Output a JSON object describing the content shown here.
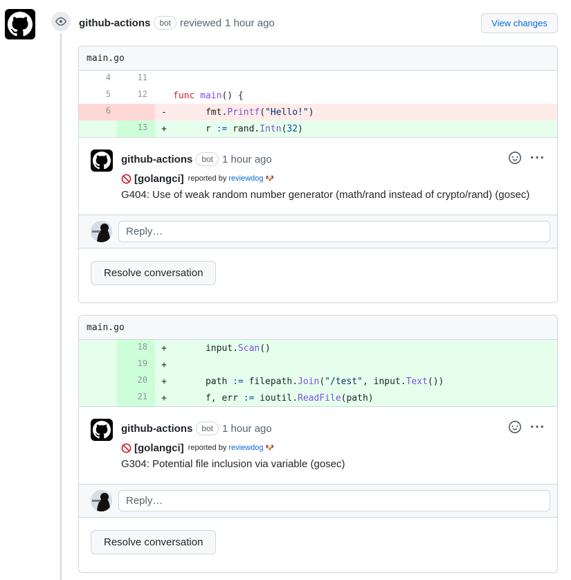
{
  "review": {
    "author": "github-actions",
    "badge": "bot",
    "action": "reviewed",
    "time": "1 hour ago",
    "view_changes_label": "View changes"
  },
  "threads": [
    {
      "file": "main.go",
      "lines": [
        {
          "old": "4",
          "new": "11",
          "marker": "",
          "type": "ctx",
          "code": ""
        },
        {
          "old": "5",
          "new": "12",
          "marker": "",
          "type": "ctx",
          "code": "func main() {"
        },
        {
          "old": "6",
          "new": "",
          "marker": "-",
          "type": "del",
          "code": "    fmt.Printf(\"Hello!\")"
        },
        {
          "old": "",
          "new": "13",
          "marker": "+",
          "type": "add",
          "code": "    r := rand.Intn(32)"
        }
      ],
      "comment": {
        "author": "github-actions",
        "badge": "bot",
        "time": "1 hour ago",
        "tag": "[golangci]",
        "reported_by": "reported by",
        "reporter": "reviewdog",
        "message": "G404: Use of weak random number generator (math/rand instead of crypto/rand) (gosec)"
      },
      "reply_placeholder": "Reply…",
      "resolve_label": "Resolve conversation"
    },
    {
      "file": "main.go",
      "lines": [
        {
          "old": "",
          "new": "18",
          "marker": "+",
          "type": "add",
          "code": "    input.Scan()"
        },
        {
          "old": "",
          "new": "19",
          "marker": "+",
          "type": "add",
          "code": ""
        },
        {
          "old": "",
          "new": "20",
          "marker": "+",
          "type": "add",
          "code": "    path := filepath.Join(\"/test\", input.Text())"
        },
        {
          "old": "",
          "new": "21",
          "marker": "+",
          "type": "add",
          "code": "    f, err := ioutil.ReadFile(path)"
        }
      ],
      "comment": {
        "author": "github-actions",
        "badge": "bot",
        "time": "1 hour ago",
        "tag": "[golangci]",
        "reported_by": "reported by",
        "reporter": "reviewdog",
        "message": "G304: Potential file inclusion via variable (gosec)"
      },
      "reply_placeholder": "Reply…",
      "resolve_label": "Resolve conversation"
    }
  ],
  "colors": {
    "accent": "#0969da",
    "added_bg": "#e6ffec",
    "deleted_bg": "#ffebe9",
    "border": "#d0d7de"
  },
  "icons": {
    "main_avatar": "github-logo-icon",
    "review_badge": "eye-icon",
    "lint_prefix": "no-entry-icon",
    "reporter_emoji": "dog-emoji-icon",
    "reaction": "smiley-icon",
    "more": "kebab-horizontal-icon"
  }
}
